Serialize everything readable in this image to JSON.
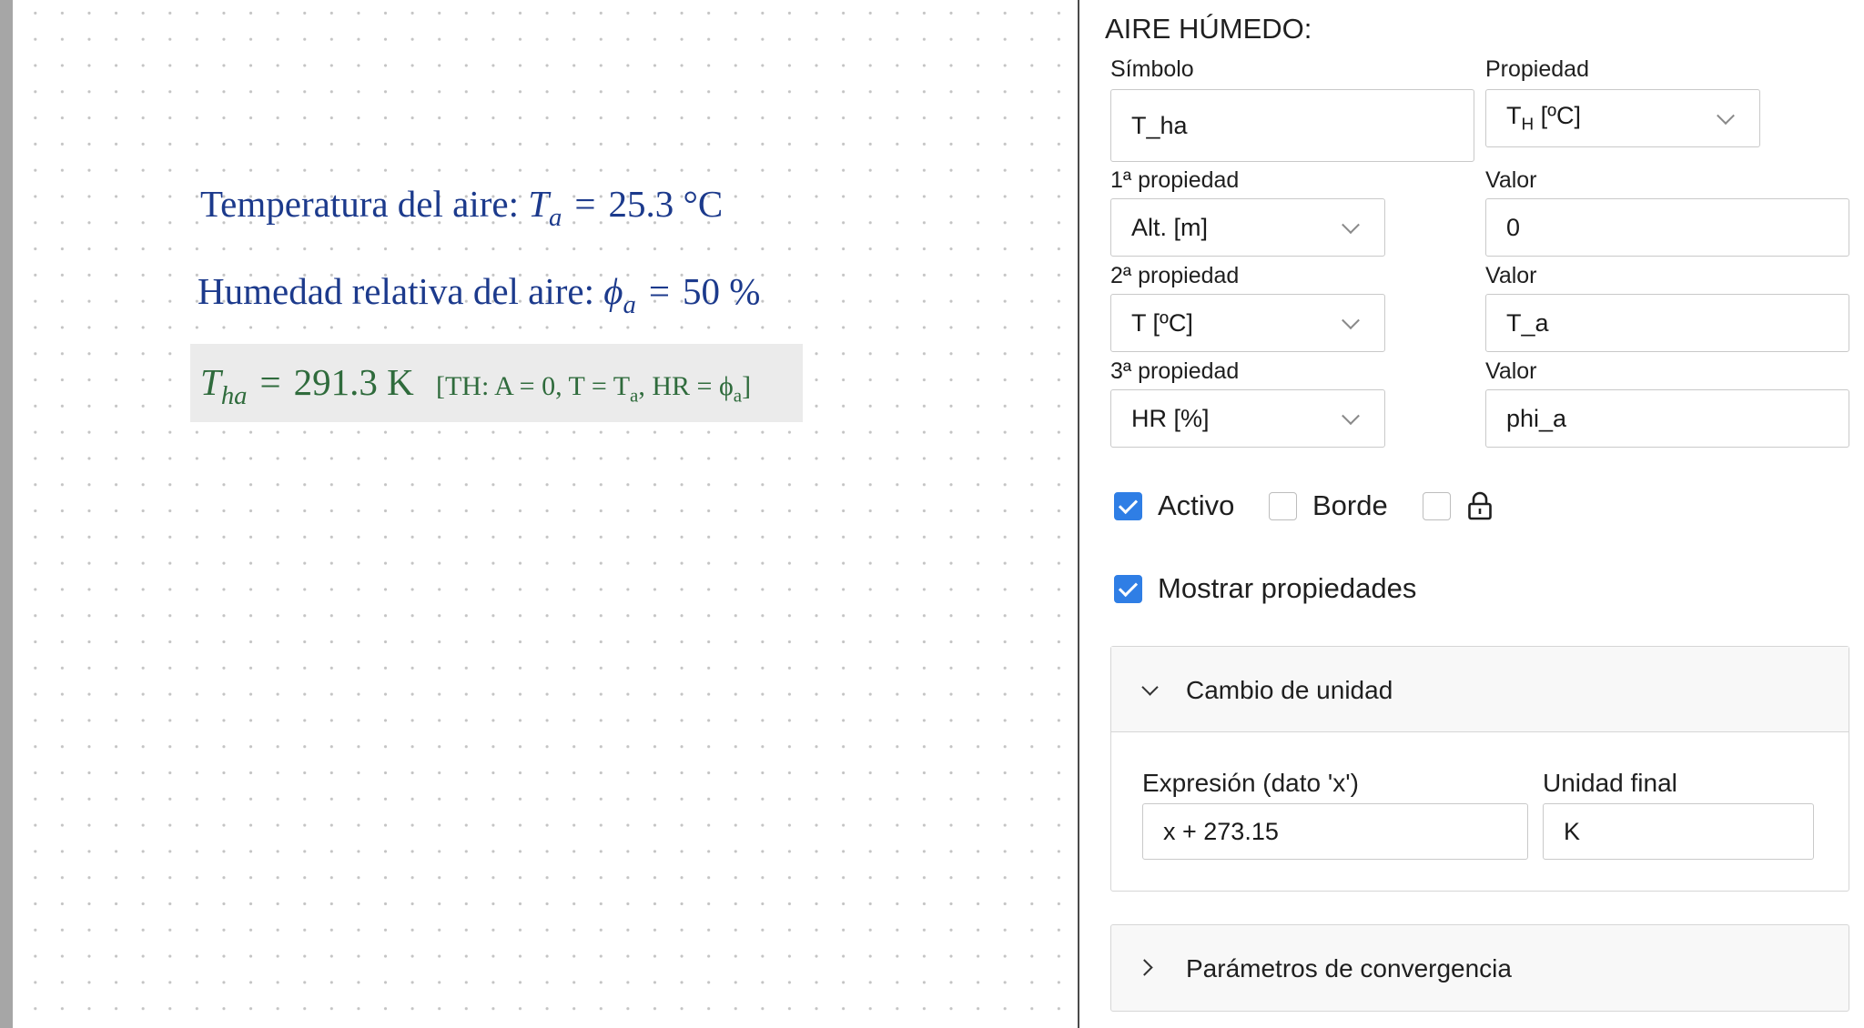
{
  "canvas": {
    "temp_line": {
      "label": "Temperatura del aire:",
      "symbol": "T",
      "sub": "a",
      "eq": "=",
      "value": "25.3 °C"
    },
    "hum_line": {
      "label": "Humedad relativa del aire:",
      "symbol": "ϕ",
      "sub": "a",
      "eq": "=",
      "value": "50 %"
    },
    "result_line": {
      "symbol": "T",
      "sub": "ha",
      "eq": "=",
      "value": "291.3 K",
      "note_prefix": "[TH: A = 0, T = T",
      "note_sub1": "a",
      "note_mid": ", HR = ϕ",
      "note_sub2": "a",
      "note_suffix": "]"
    },
    "colors": {
      "input_text": "#1c3a8c",
      "result_text": "#2f6b3c",
      "result_bg": "#ebebeb"
    }
  },
  "panel": {
    "title": "AIRE HÚMEDO:",
    "symbol_label": "Símbolo",
    "symbol_value": "T_ha",
    "property_label": "Propiedad",
    "property_value_main": "T",
    "property_value_sub": "H",
    "property_value_unit": " [ºC]",
    "prop1_label": "1ª propiedad",
    "prop1_value": "Alt. [m]",
    "val1_label": "Valor",
    "val1_value": "0",
    "prop2_label": "2ª propiedad",
    "prop2_value": "T [ºC]",
    "val2_label": "Valor",
    "val2_value": "T_a",
    "prop3_label": "3ª propiedad",
    "prop3_value": "HR [%]",
    "val3_label": "Valor",
    "val3_value": "phi_a",
    "activo_label": "Activo",
    "activo_checked": true,
    "borde_label": "Borde",
    "borde_checked": false,
    "lock_checked": false,
    "mostrar_label": "Mostrar propiedades",
    "mostrar_checked": true,
    "unit_change": {
      "title": "Cambio de unidad",
      "expanded": true,
      "expr_label": "Expresión (dato 'x')",
      "expr_value": "x + 273.15",
      "final_unit_label": "Unidad final",
      "final_unit_value": "K"
    },
    "convergence": {
      "title": "Parámetros de convergencia",
      "expanded": false
    },
    "accent_color": "#2f7ee5"
  }
}
